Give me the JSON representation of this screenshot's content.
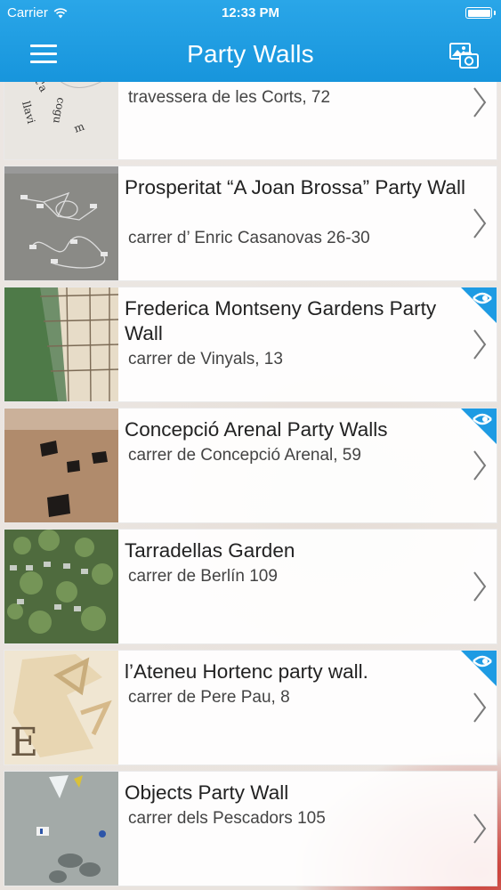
{
  "status_bar": {
    "carrier": "Carrier",
    "time": "12:33 PM"
  },
  "nav_bar": {
    "title": "Party Walls",
    "menu_icon": "hamburger-menu-icon",
    "right_icon": "photo-camera-icon"
  },
  "colors": {
    "header": "#1b99df",
    "badge": "#1e9be3",
    "row_background": "#ffffff",
    "chevron": "#7a7a7a"
  },
  "items": [
    {
      "title": "",
      "subtitle": "travessera de les Corts, 72",
      "has_badge": false,
      "thumb": "text-mural-thumbnail"
    },
    {
      "title": "Prosperitat “A Joan Brossa” Party Wall",
      "subtitle": "carrer d’ Enric Casanovas 26-30",
      "has_badge": false,
      "thumb": "rope-sculpture-thumbnail"
    },
    {
      "title": "Frederica Montseny Gardens Party Wall",
      "subtitle": "carrer de Vinyals, 13",
      "has_badge": true,
      "thumb": "scaffold-wall-thumbnail"
    },
    {
      "title": "Concepció Arenal Party Walls",
      "subtitle": "carrer de Concepció Arenal, 59",
      "has_badge": true,
      "thumb": "brown-wall-windows-thumbnail"
    },
    {
      "title": "Tarradellas Garden",
      "subtitle": "carrer de Berlín 109",
      "has_badge": false,
      "thumb": "vertical-garden-thumbnail"
    },
    {
      "title": "l’Ateneu Hortenc party wall.",
      "subtitle": "carrer de Pere Pau, 8",
      "has_badge": true,
      "thumb": "letters-mural-thumbnail"
    },
    {
      "title": "Objects Party Wall",
      "subtitle": "carrer dels Pescadors 105",
      "has_badge": false,
      "thumb": "objects-wall-thumbnail"
    }
  ]
}
